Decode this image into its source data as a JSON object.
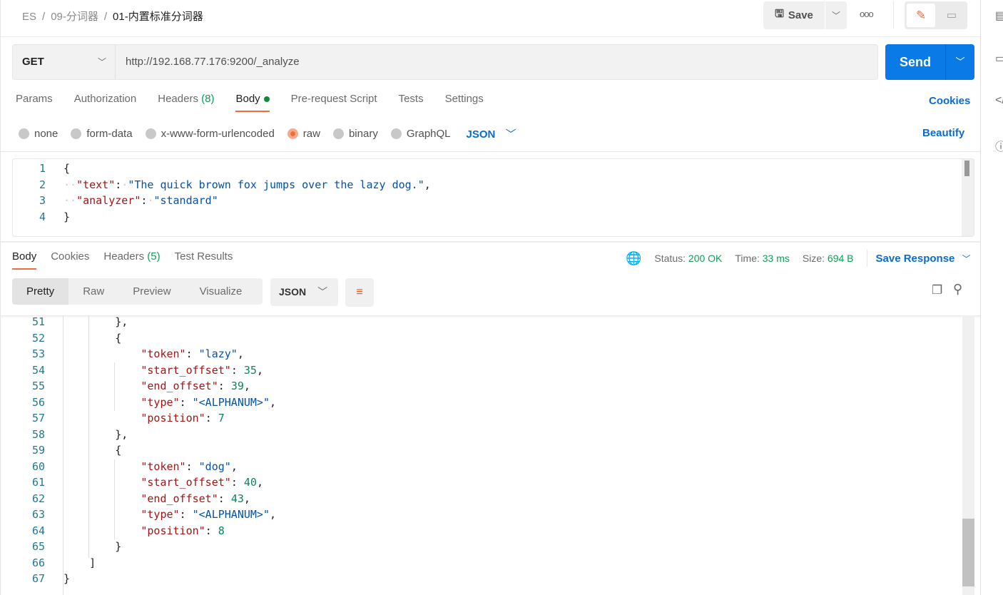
{
  "breadcrumb": {
    "items": [
      "ES",
      "09-分词器"
    ],
    "current": "01-内置标准分词器",
    "sep": "/"
  },
  "toolbar": {
    "save_label": "Save",
    "more": "ooo"
  },
  "request": {
    "method": "GET",
    "url": "http://192.168.77.176:9200/_analyze",
    "send_label": "Send"
  },
  "req_tabs": [
    {
      "label": "Params"
    },
    {
      "label": "Authorization"
    },
    {
      "label": "Headers",
      "count": "(8)"
    },
    {
      "label": "Body",
      "active": true
    },
    {
      "label": "Pre-request Script"
    },
    {
      "label": "Tests"
    },
    {
      "label": "Settings"
    }
  ],
  "cookies_label": "Cookies",
  "body_types": [
    {
      "label": "none"
    },
    {
      "label": "form-data"
    },
    {
      "label": "x-www-form-urlencoded"
    },
    {
      "label": "raw",
      "selected": true
    },
    {
      "label": "binary"
    },
    {
      "label": "GraphQL"
    }
  ],
  "raw_format": "JSON",
  "beautify_label": "Beautify",
  "request_body": [
    "{",
    "  \"text\": \"The quick brown fox jumps over the lazy dog.\",",
    "  \"analyzer\": \"standard\"",
    "}"
  ],
  "response": {
    "tabs": [
      {
        "label": "Body",
        "active": true
      },
      {
        "label": "Cookies"
      },
      {
        "label": "Headers",
        "count": "(5)"
      },
      {
        "label": "Test Results"
      }
    ],
    "status_label": "Status:",
    "status": "200 OK",
    "time_label": "Time:",
    "time": "33 ms",
    "size_label": "Size:",
    "size": "694 B",
    "save_response": "Save Response",
    "formats": [
      "Pretty",
      "Raw",
      "Preview",
      "Visualize"
    ],
    "language": "JSON",
    "first_line": 51,
    "lines": [
      "        },",
      "        {",
      "            \"token\": \"lazy\",",
      "            \"start_offset\": 35,",
      "            \"end_offset\": 39,",
      "            \"type\": \"<ALPHANUM>\",",
      "            \"position\": 7",
      "        },",
      "        {",
      "            \"token\": \"dog\",",
      "            \"start_offset\": 40,",
      "            \"end_offset\": 43,",
      "            \"type\": \"<ALPHANUM>\",",
      "            \"position\": 8",
      "        }",
      "    ]",
      "}"
    ]
  },
  "colors": {
    "accent": "#f26b3a",
    "primary": "#0a7ae6",
    "link": "#0b6bd0",
    "success": "#0f9d58"
  }
}
